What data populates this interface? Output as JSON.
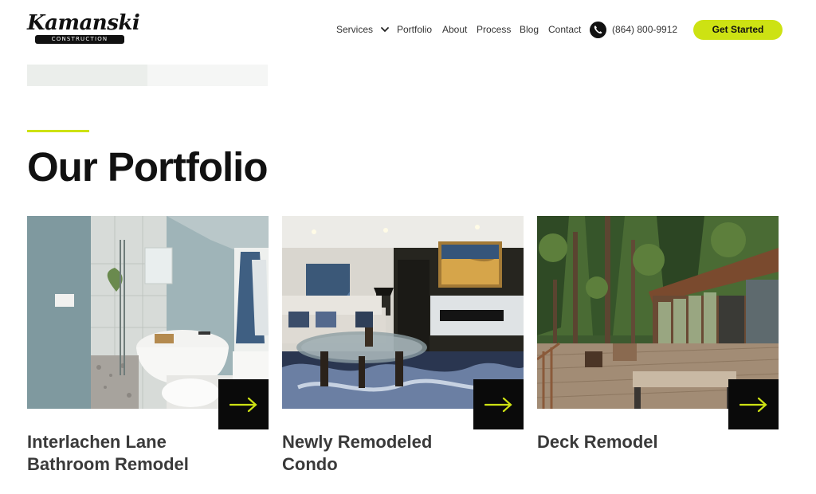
{
  "brand": {
    "script_name": "Kamanski",
    "band_text": "CONSTRUCTION"
  },
  "nav": {
    "items": [
      "Services",
      "Portfolio",
      "About",
      "Process",
      "Blog",
      "Contact"
    ],
    "phone": "(864) 800-9912",
    "cta_label": "Get Started"
  },
  "slider_progress": 0.5,
  "section": {
    "title": "Our Portfolio"
  },
  "portfolio": [
    {
      "title": "Interlachen Lane Bathroom Remodel",
      "image": "bathroom-photo"
    },
    {
      "title": "Newly Remodeled Condo",
      "image": "living-room-photo"
    },
    {
      "title": "Deck Remodel",
      "image": "deck-photo"
    }
  ],
  "colors": {
    "accent": "#cde213",
    "text": "#111111",
    "card_title": "#3a3a3a",
    "arrow_bg": "#0a0a0a"
  },
  "icons": {
    "dropdown": "chevron-down-icon",
    "phone": "phone-icon",
    "card_link": "arrow-right-icon"
  }
}
